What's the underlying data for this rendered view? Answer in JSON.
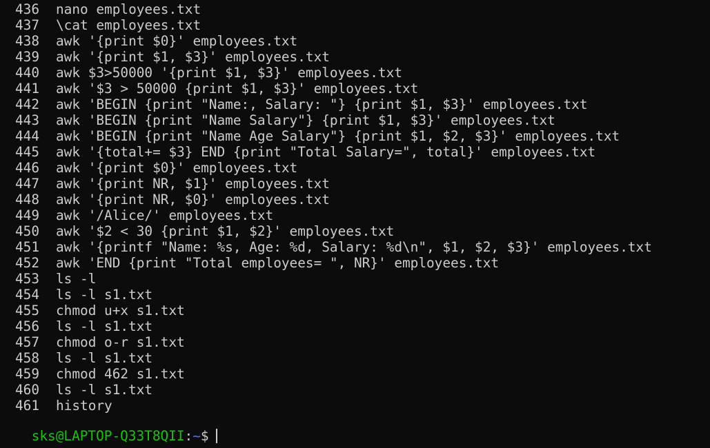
{
  "terminal": {
    "history": [
      {
        "num": "436",
        "cmd": "nano employees.txt"
      },
      {
        "num": "437",
        "cmd": "\\cat employees.txt"
      },
      {
        "num": "438",
        "cmd": "awk '{print $0}' employees.txt"
      },
      {
        "num": "439",
        "cmd": "awk '{print $1, $3}' employees.txt"
      },
      {
        "num": "440",
        "cmd": "awk $3>50000 '{print $1, $3}' employees.txt"
      },
      {
        "num": "441",
        "cmd": "awk '$3 > 50000 {print $1, $3}' employees.txt"
      },
      {
        "num": "442",
        "cmd": "awk 'BEGIN {print \"Name:, Salary: \"} {print $1, $3}' employees.txt"
      },
      {
        "num": "443",
        "cmd": "awk 'BEGIN {print \"Name Salary\"} {print $1, $3}' employees.txt"
      },
      {
        "num": "444",
        "cmd": "awk 'BEGIN {print \"Name Age Salary\"} {print $1, $2, $3}' employees.txt"
      },
      {
        "num": "445",
        "cmd": "awk '{total+= $3} END {print \"Total Salary=\", total}' employees.txt"
      },
      {
        "num": "446",
        "cmd": "awk '{print $0}' employees.txt"
      },
      {
        "num": "447",
        "cmd": "awk '{print NR, $1}' employees.txt"
      },
      {
        "num": "448",
        "cmd": "awk '{print NR, $0}' employees.txt"
      },
      {
        "num": "449",
        "cmd": "awk '/Alice/' employees.txt"
      },
      {
        "num": "450",
        "cmd": "awk '$2 < 30 {print $1, $2}' employees.txt"
      },
      {
        "num": "451",
        "cmd": "awk '{printf \"Name: %s, Age: %d, Salary: %d\\n\", $1, $2, $3}' employees.txt"
      },
      {
        "num": "452",
        "cmd": "awk 'END {print \"Total employees= \", NR}' employees.txt"
      },
      {
        "num": "453",
        "cmd": "ls -l"
      },
      {
        "num": "454",
        "cmd": "ls -l s1.txt"
      },
      {
        "num": "455",
        "cmd": "chmod u+x s1.txt"
      },
      {
        "num": "456",
        "cmd": "ls -l s1.txt"
      },
      {
        "num": "457",
        "cmd": "chmod o-r s1.txt"
      },
      {
        "num": "458",
        "cmd": "ls -l s1.txt"
      },
      {
        "num": "459",
        "cmd": "chmod 462 s1.txt"
      },
      {
        "num": "460",
        "cmd": "ls -l s1.txt"
      },
      {
        "num": "461",
        "cmd": "history"
      }
    ],
    "prompt": {
      "user_host": "sks@LAPTOP-Q33T8QII",
      "separator": ":",
      "path": "~",
      "symbol": "$"
    }
  },
  "colors": {
    "background": "#0c0c0c",
    "foreground": "#cccccc",
    "user_host": "#16c60c",
    "path": "#3b78ff"
  }
}
